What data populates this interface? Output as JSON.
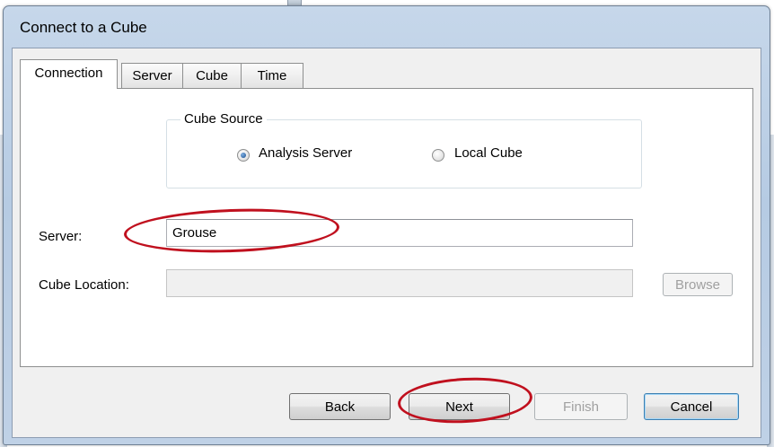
{
  "window": {
    "title": "Connect to a Cube"
  },
  "tabs": [
    {
      "label": "Connection",
      "active": true
    },
    {
      "label": "Server",
      "active": false
    },
    {
      "label": "Cube",
      "active": false
    },
    {
      "label": "Time",
      "active": false
    }
  ],
  "cube_source": {
    "legend": "Cube Source",
    "options": [
      {
        "label": "Analysis Server",
        "selected": true
      },
      {
        "label": "Local Cube",
        "selected": false
      }
    ]
  },
  "server": {
    "label": "Server:",
    "value": "Grouse"
  },
  "cube_location": {
    "label": "Cube Location:",
    "value": "",
    "browse_label": "Browse"
  },
  "buttons": {
    "back": "Back",
    "next": "Next",
    "finish": "Finish",
    "cancel": "Cancel"
  },
  "colors": {
    "annotation": "#c0101e",
    "title_bar": "#b9cde4"
  }
}
